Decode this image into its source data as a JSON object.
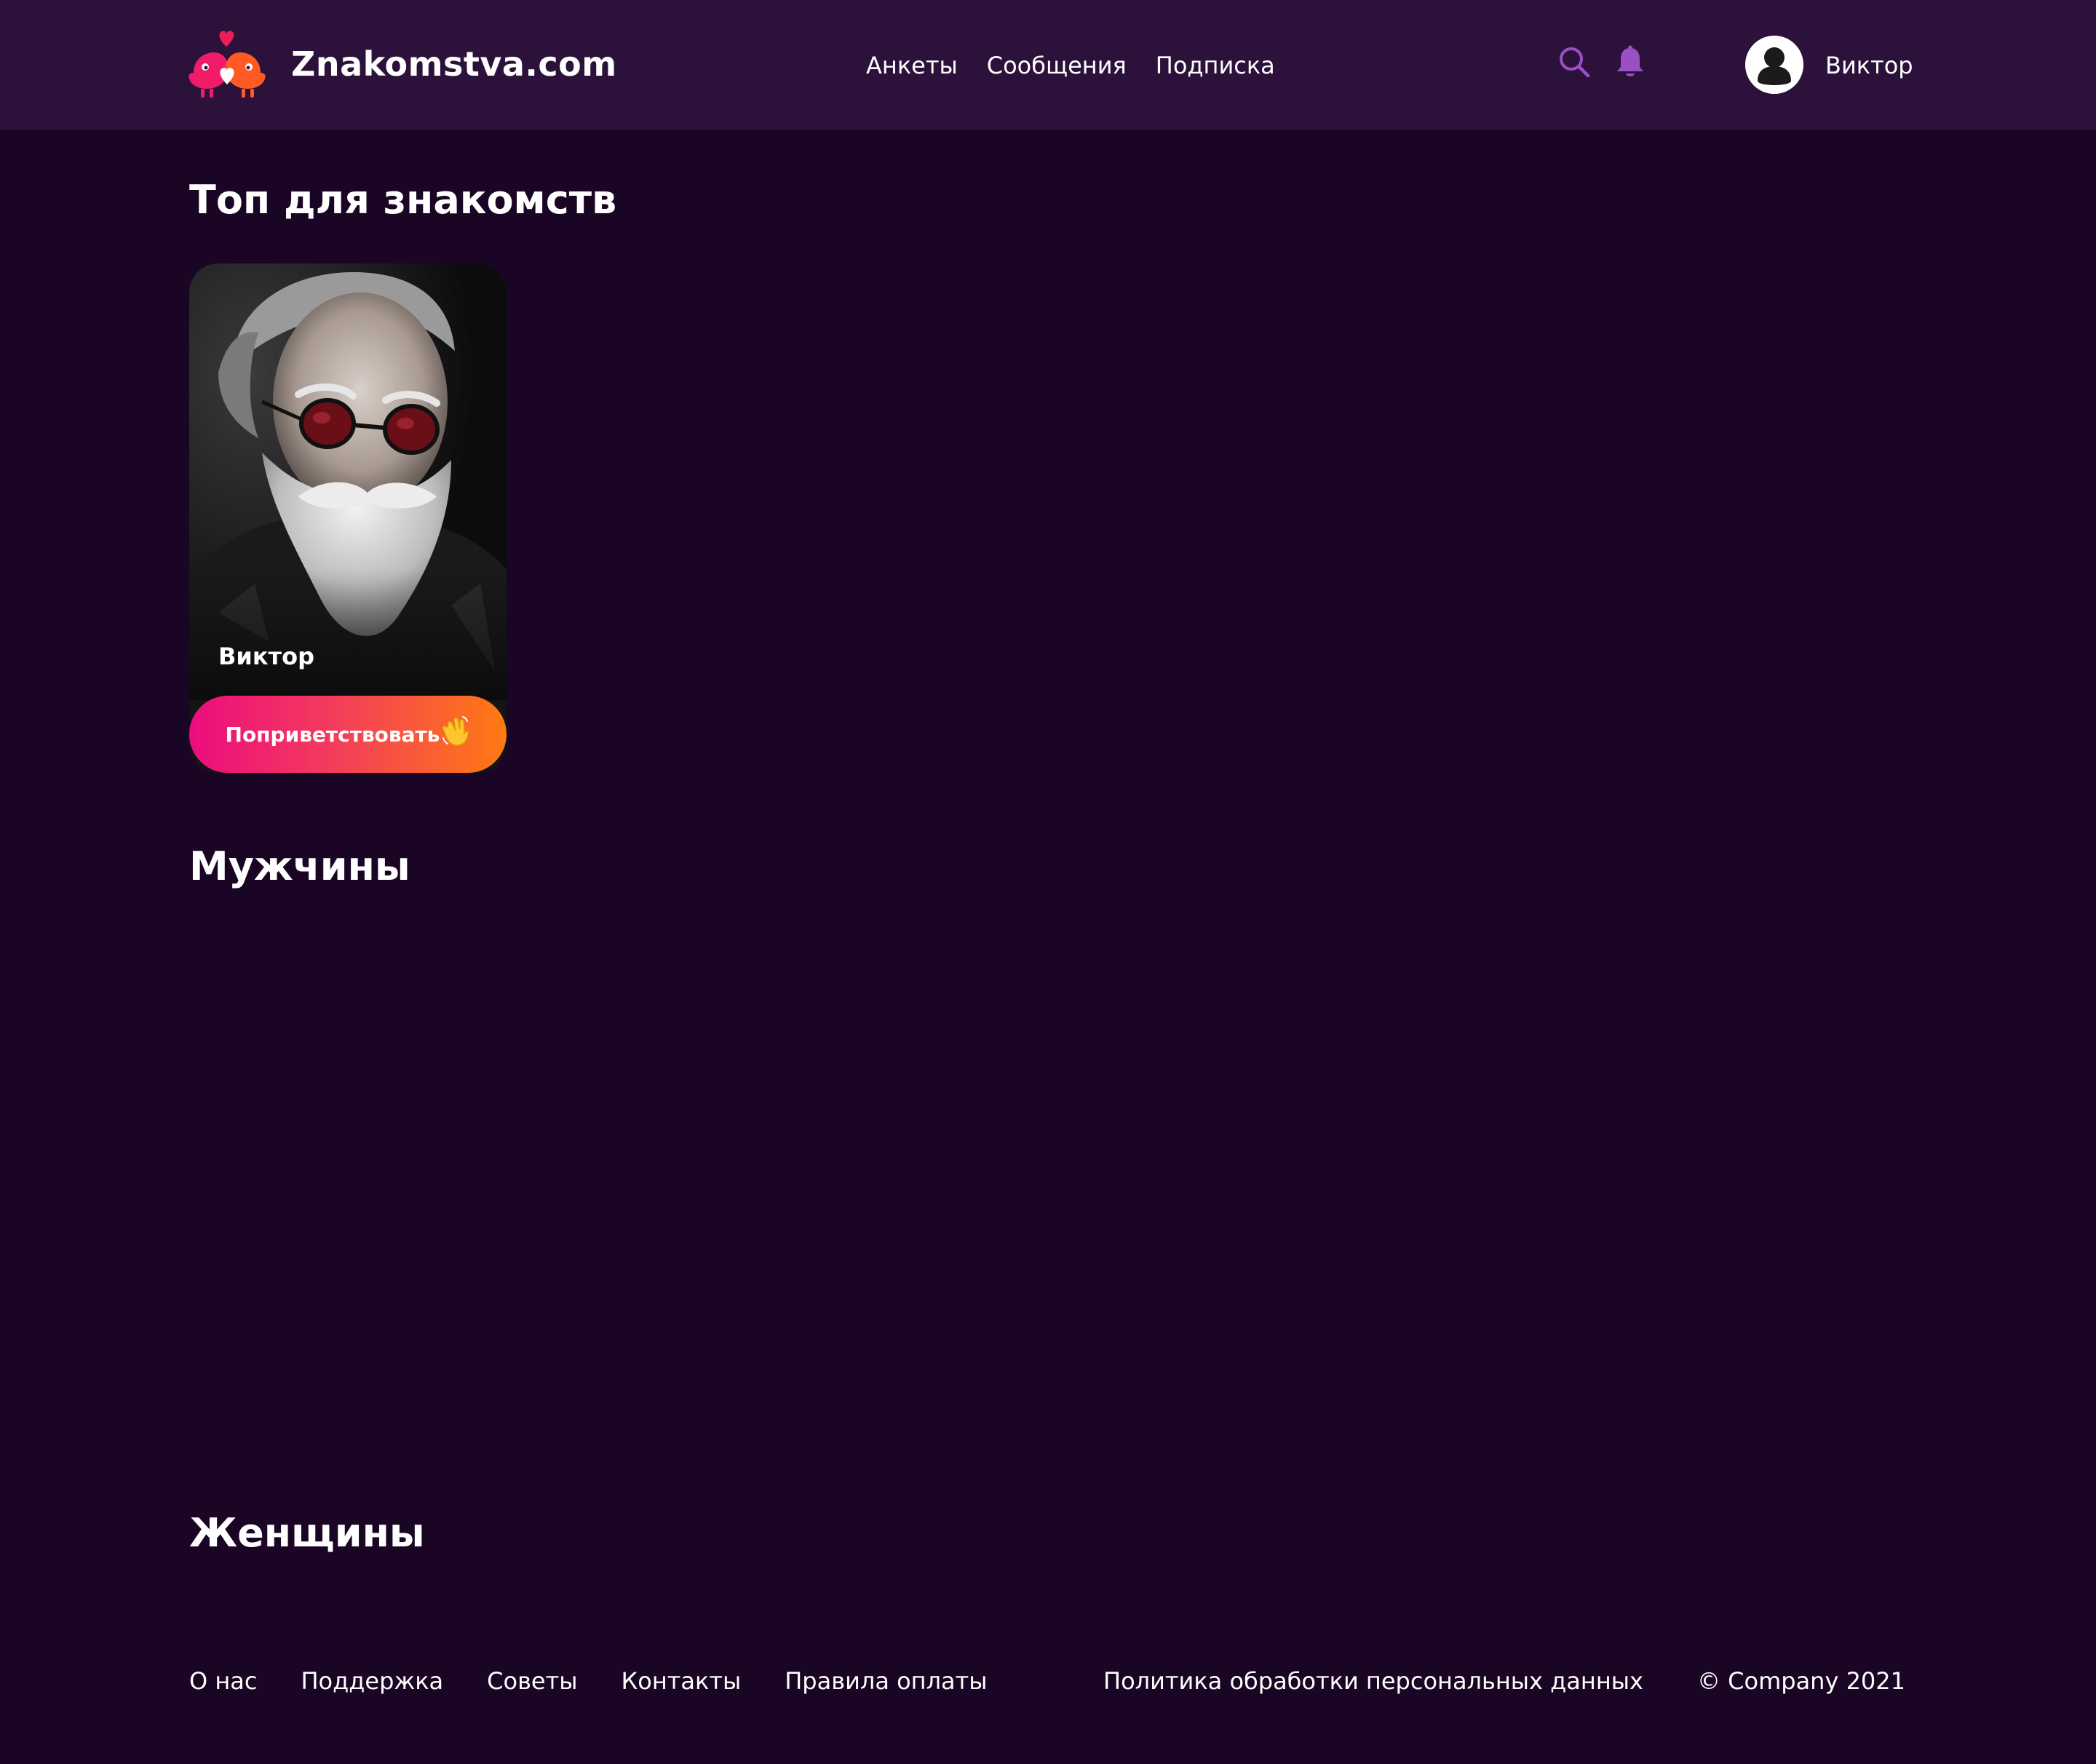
{
  "header": {
    "brand": "Znakomstva.com",
    "nav": [
      "Анкеты",
      "Сообщения",
      "Подписка"
    ],
    "user_name": "Виктор"
  },
  "sections": {
    "top_title": "Топ для знакомств",
    "men_title": "Мужчины",
    "women_title": "Женщины"
  },
  "top_card": {
    "name": "Виктор",
    "greet_label": "Поприветствовать"
  },
  "footer": {
    "links": [
      "О нас",
      "Поддержка",
      "Советы",
      "Контакты",
      "Правила оплаты"
    ],
    "policy": "Политика обработки персональных данных",
    "copyright": "© Company 2021"
  },
  "colors": {
    "background": "#1b0524",
    "header": "#2c123b",
    "accent_icon": "#9b4fc4",
    "button_gradient_start": "#ec0c7e",
    "button_gradient_end": "#ff7a13"
  },
  "icons": [
    "logo-icon",
    "search-icon",
    "bell-icon",
    "user-avatar-icon",
    "waving-hand-icon"
  ]
}
